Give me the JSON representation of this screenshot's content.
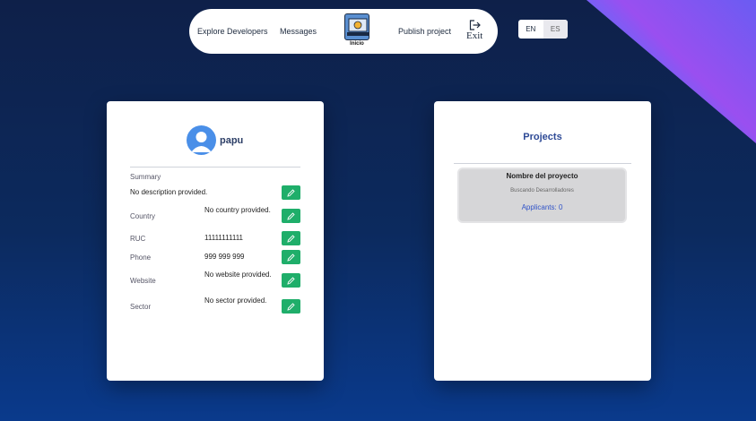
{
  "nav": {
    "explore_label": "Explore Developers",
    "messages_label": "Messages",
    "logo_caption": "Inicio",
    "publish_label": "Publish project",
    "exit_label": "Exit"
  },
  "lang": {
    "en": "EN",
    "es": "ES",
    "active": "EN"
  },
  "profile": {
    "username": "papu",
    "summary_label": "Summary",
    "summary_value": "No description provided.",
    "fields": [
      {
        "label": "Country",
        "value": "No country provided."
      },
      {
        "label": "RUC",
        "value": "11111111111"
      },
      {
        "label": "Phone",
        "value": "999 999 999"
      },
      {
        "label": "Website",
        "value": "No website provided."
      },
      {
        "label": "Sector",
        "value": "No sector provided."
      }
    ]
  },
  "projects": {
    "title": "Projects",
    "items": [
      {
        "name": "Nombre del proyecto",
        "status": "Buscando Desarrolladores",
        "applicants": "Applicants: 0"
      }
    ]
  },
  "colors": {
    "accent": "#1fae6a",
    "link": "#2f52c8",
    "title": "#2e4a96"
  }
}
